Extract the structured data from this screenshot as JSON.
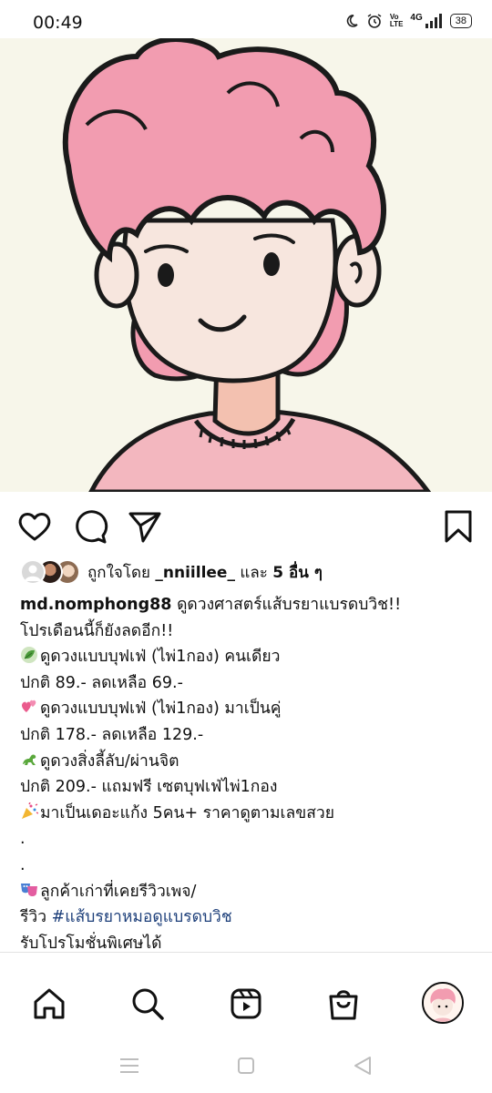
{
  "status_bar": {
    "time": "00:49",
    "network": "4G",
    "volte_top": "Vo",
    "volte_bottom": "LTE",
    "battery": "38"
  },
  "post": {
    "likes": {
      "prefix": "ถูกใจโดย",
      "user": "_nniillee_",
      "and": "และ",
      "others": "5 อื่น ๆ"
    },
    "caption": {
      "username": "md.nomphong88",
      "headline": "ดูดวงศาสตร์แส้บรยาแบรดบวิช!!",
      "lines": [
        "โปรเดือนนี้ก็ยังลดอีก!!",
        "ดูดวงแบบบุฟเฟ่ (ไพ่1กอง) คนเดียว",
        "ปกติ 89.- ลดเหลือ 69.-",
        "ดูดวงแบบบุฟเฟ่ (ไพ่1กอง) มาเป็นคู่",
        "ปกติ 178.- ลดเหลือ 129.-",
        "ดูดวงสิ่งลี้ลับ/ผ่านจิต",
        "ปกติ 209.- แถมฟรี เซตบุฟเฟ่ไพ่1กอง",
        "มาเป็นเดอะแก้ง 5คน+ ราคาดูตามเลขสวย",
        ".",
        ".",
        "ลูกค้าเก่าที่เคยรีวิวเพจ/",
        "รีวิว",
        "รับโปรโมชั่นพิเศษได้"
      ],
      "hashtag": "#แส้บรยาหมอดูแบรดบวิช"
    }
  },
  "icons": {
    "like": "heart-icon",
    "comment": "comment-icon",
    "share": "send-icon",
    "save": "bookmark-icon",
    "home": "home-icon",
    "search": "search-icon",
    "reels": "reels-icon",
    "shop": "shop-bag-icon"
  }
}
